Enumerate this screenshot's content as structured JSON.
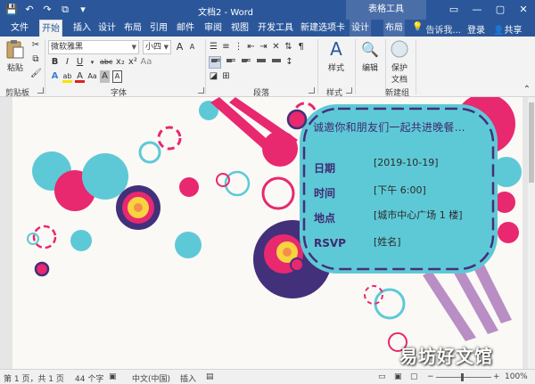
{
  "titlebar": {
    "doc_title": "文档2 - Word",
    "context_group": "表格工具",
    "qat": [
      "💾",
      "↶",
      "↷",
      "⧉",
      "▾"
    ],
    "win_controls": [
      "▭",
      "—",
      "▢",
      "✕"
    ]
  },
  "tabs": [
    {
      "label": "文件"
    },
    {
      "label": "开始"
    },
    {
      "label": "插入"
    },
    {
      "label": "设计"
    },
    {
      "label": "布局"
    },
    {
      "label": "引用"
    },
    {
      "label": "邮件"
    },
    {
      "label": "审阅"
    },
    {
      "label": "视图"
    },
    {
      "label": "开发工具"
    },
    {
      "label": "新建选项卡"
    },
    {
      "label": "设计"
    },
    {
      "label": "布局"
    }
  ],
  "tellme": {
    "icon": "💡",
    "text": "告诉我..."
  },
  "account": {
    "login": "登录",
    "share": "共享",
    "share_icon": "👤"
  },
  "ribbon": {
    "paste_label": "粘贴",
    "font_name": "微软雅黑",
    "font_size": "小四",
    "styles_label": "样式",
    "edit_label": "编辑",
    "protect_label": "保护",
    "protect_sub": "文档",
    "groups": {
      "clipboard": "剪贴板",
      "font": "字体",
      "paragraph": "段落",
      "styles": "样式",
      "new_group": "新建组"
    },
    "font_buttons": [
      "B",
      "I",
      "U",
      "abc",
      "x₂",
      "x²"
    ],
    "font_buttons2": [
      "A",
      "ab",
      "A",
      "Aa",
      "A",
      "A"
    ],
    "font_size_buttons": [
      "A",
      "A",
      "Aa"
    ]
  },
  "document": {
    "invite_title": "诚邀你和朋友们一起共进晚餐…",
    "fields": [
      {
        "label": "日期",
        "value": "[2019-10-19]"
      },
      {
        "label": "时间",
        "value": "[下午 6:00]"
      },
      {
        "label": "地点",
        "value": "[城市中心广场 1 楼]"
      },
      {
        "label": "RSVP",
        "value": "[姓名]"
      }
    ]
  },
  "colors": {
    "word_blue": "#2b579a",
    "card_teal": "#5ec9d6",
    "magenta": "#e8286f",
    "purple": "#43307a",
    "yellow": "#f7d33f",
    "orange": "#f2904a",
    "lilac": "#b98ec4"
  },
  "statusbar": {
    "page": "第 1 页，共 1 页",
    "words": "44 个字",
    "lang": "中文(中国)",
    "mode": "插入",
    "zoom_minus": "−",
    "zoom_plus": "+",
    "zoom": "100%"
  },
  "watermark": "易坊好文馆"
}
